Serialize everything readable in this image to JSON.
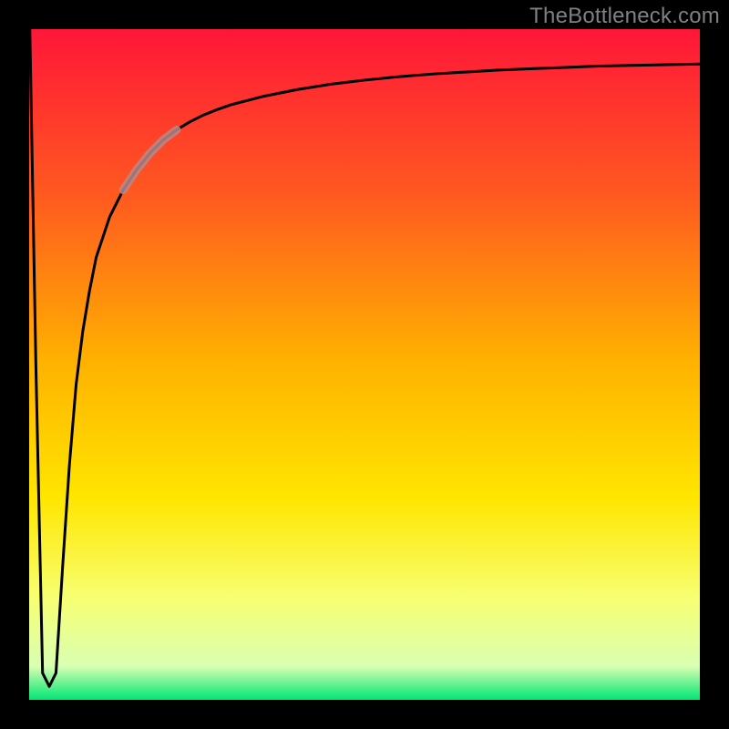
{
  "chart_data": {
    "type": "line",
    "title": "",
    "xlabel": "",
    "ylabel": "",
    "watermark": "TheBottleneck.com",
    "xlim": [
      0,
      100
    ],
    "ylim": [
      0,
      100
    ],
    "gradient_stops": [
      {
        "offset": 0,
        "color": "#ff1638"
      },
      {
        "offset": 25,
        "color": "#ff5a1f"
      },
      {
        "offset": 50,
        "color": "#ffb300"
      },
      {
        "offset": 70,
        "color": "#ffe600"
      },
      {
        "offset": 85,
        "color": "#f7ff73"
      },
      {
        "offset": 95,
        "color": "#d9ffb3"
      },
      {
        "offset": 100,
        "color": "#00e673"
      }
    ],
    "series": [
      {
        "name": "bottleneck-curve",
        "stroke": "#000000",
        "x": [
          0.1,
          1,
          2,
          3,
          4,
          5,
          6,
          7,
          8,
          9,
          10,
          12,
          14,
          16,
          18,
          20,
          22,
          24,
          26,
          28,
          30,
          35,
          40,
          45,
          50,
          55,
          60,
          65,
          70,
          75,
          80,
          85,
          90,
          95,
          100
        ],
        "y": [
          100,
          50,
          4,
          2,
          4,
          20,
          35,
          47,
          55,
          61,
          66,
          72,
          76,
          79,
          81.5,
          83.5,
          85,
          86.2,
          87.2,
          88,
          88.7,
          90,
          91,
          91.8,
          92.4,
          92.9,
          93.3,
          93.6,
          93.9,
          94.1,
          94.3,
          94.5,
          94.6,
          94.7,
          94.8
        ]
      }
    ],
    "highlight": {
      "name": "emphasized-segment",
      "stroke": "#b88a8a",
      "x_range": [
        14,
        22
      ],
      "description": "highlighted portion of the curve between x≈14 and x≈22"
    }
  }
}
